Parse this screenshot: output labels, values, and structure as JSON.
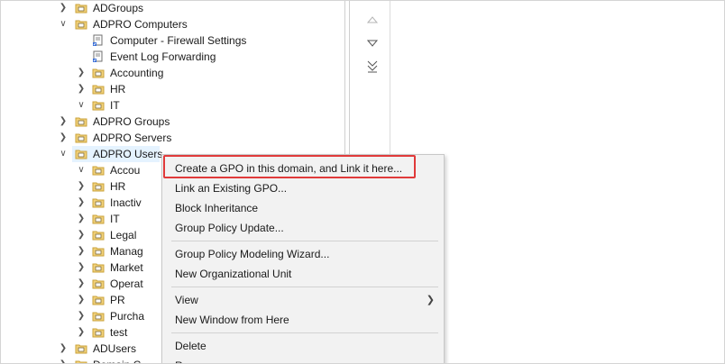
{
  "tree": {
    "items": [
      {
        "label": "ADGroups",
        "chev": "closed",
        "icon": "folder-ou-icon"
      },
      {
        "label": "ADPRO Computers",
        "chev": "open",
        "icon": "folder-ou-icon"
      },
      {
        "label": "Computer - Firewall Settings",
        "chev": "",
        "icon": "gpo-link-icon"
      },
      {
        "label": "Event Log Forwarding",
        "chev": "",
        "icon": "gpo-link-icon"
      },
      {
        "label": "Accounting",
        "chev": "closed",
        "icon": "folder-ou-icon"
      },
      {
        "label": "HR",
        "chev": "closed",
        "icon": "folder-ou-icon"
      },
      {
        "label": "IT",
        "chev": "open",
        "icon": "folder-ou-icon"
      },
      {
        "label": "ADPRO Groups",
        "chev": "closed",
        "icon": "folder-ou-icon"
      },
      {
        "label": "ADPRO Servers",
        "chev": "closed",
        "icon": "folder-ou-icon"
      },
      {
        "label": "ADPRO Users",
        "chev": "open",
        "icon": "folder-ou-icon"
      },
      {
        "label": "Accou",
        "chev": "open",
        "icon": "folder-ou-icon"
      },
      {
        "label": "HR",
        "chev": "closed",
        "icon": "folder-ou-icon"
      },
      {
        "label": "Inactiv",
        "chev": "closed",
        "icon": "folder-ou-icon"
      },
      {
        "label": "IT",
        "chev": "closed",
        "icon": "folder-ou-icon"
      },
      {
        "label": "Legal",
        "chev": "closed",
        "icon": "folder-ou-icon"
      },
      {
        "label": "Manag",
        "chev": "closed",
        "icon": "folder-ou-icon"
      },
      {
        "label": "Market",
        "chev": "closed",
        "icon": "folder-ou-icon"
      },
      {
        "label": "Operat",
        "chev": "closed",
        "icon": "folder-ou-icon"
      },
      {
        "label": "PR",
        "chev": "closed",
        "icon": "folder-ou-icon"
      },
      {
        "label": "Purcha",
        "chev": "closed",
        "icon": "folder-ou-icon"
      },
      {
        "label": "test",
        "chev": "closed",
        "icon": "folder-ou-icon"
      },
      {
        "label": "ADUsers",
        "chev": "closed",
        "icon": "folder-ou-icon"
      },
      {
        "label": "Domain C",
        "chev": "closed",
        "icon": "folder-ou-icon"
      }
    ]
  },
  "context_menu": {
    "items": [
      {
        "label": "Create a GPO in this domain, and Link it here...",
        "highlighted": true
      },
      {
        "label": "Link an Existing GPO..."
      },
      {
        "label": "Block Inheritance"
      },
      {
        "label": "Group Policy Update..."
      },
      {
        "label": "Group Policy Modeling Wizard..."
      },
      {
        "label": "New Organizational Unit"
      },
      {
        "label": "View",
        "submenu": true
      },
      {
        "label": "New Window from Here"
      },
      {
        "label": "Delete"
      },
      {
        "label": "R"
      }
    ]
  },
  "colors": {
    "highlight_border": "#e03a3a",
    "selection_bg": "#e5f3ff",
    "menu_bg": "#f2f2f2"
  }
}
